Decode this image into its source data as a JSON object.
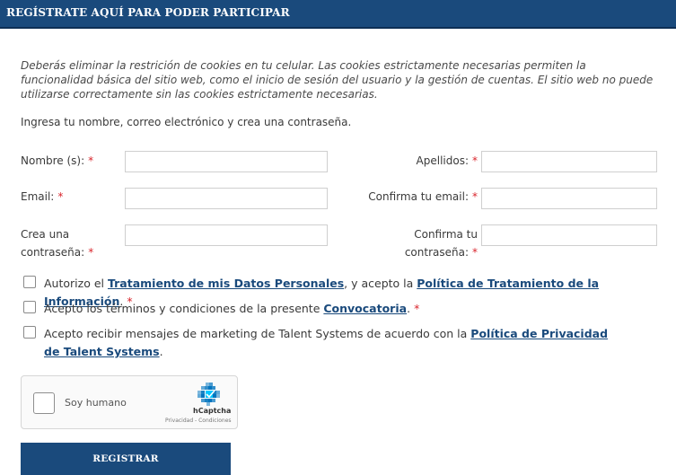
{
  "header": {
    "title": "REGÍSTRATE AQUÍ PARA PODER PARTICIPAR"
  },
  "notice": "Deberás eliminar la restrición de cookies en tu celular. Las cookies estrictamente necesarias permiten la funcionalidad básica del sitio web, como el inicio de sesión del usuario y la gestión de cuentas. El sitio web no puede utilizarse correctamente sin las cookies estrictamente necesarias.",
  "intro": "Ingresa tu nombre, correo electrónico y crea una contraseña.",
  "form": {
    "required_mark": "*",
    "first_name_label": "Nombre (s):",
    "last_name_label": "Apellidos:",
    "email_label": "Email:",
    "confirm_email_label": "Confirma tu email:",
    "password_label_1": "Crea una",
    "password_label_2": "contraseña:",
    "confirm_password_label_1": "Confirma tu",
    "confirm_password_label_2": "contraseña:"
  },
  "consents": {
    "c1_pre": "Autorizo el ",
    "c1_link1": "Tratamiento de mis Datos Personales",
    "c1_mid": ", y acepto la ",
    "c1_link2": "Política de Tratamiento de la Información",
    "c1_end": ".",
    "c2_pre": "Acepto los términos y condiciones de la presente ",
    "c2_link": "Convocatoria",
    "c2_end": ".",
    "c3_pre": "Acepto recibir mensajes de marketing de Talent Systems de acuerdo con la ",
    "c3_link": "Política de Privacidad de Talent Systems",
    "c3_end": "."
  },
  "captcha": {
    "label": "Soy humano",
    "brand": "hCaptcha",
    "links": "Privacidad - Condiciones"
  },
  "submit_label": "REGISTRAR",
  "colors": {
    "primary": "#1a4a7c",
    "required": "#d9252c"
  }
}
